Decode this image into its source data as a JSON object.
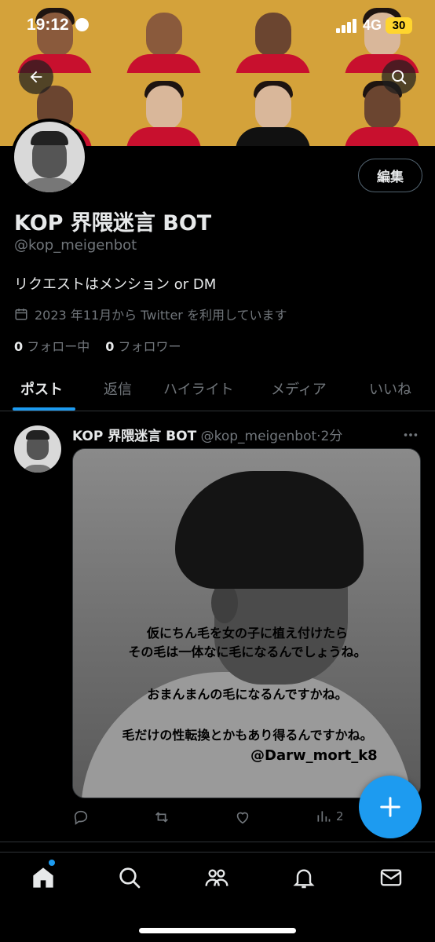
{
  "status_bar": {
    "time": "19:12",
    "network": "4G",
    "battery": "30"
  },
  "banner": {
    "description_icons": [
      "arrow-left-icon",
      "search-icon"
    ]
  },
  "profile": {
    "name": "KOP 界隈迷言 BOT",
    "handle": "@kop_meigenbot",
    "bio": "リクエストはメンション or DM",
    "joined": "2023 年11月から Twitter を利用しています",
    "following_count": "0",
    "following_label": "フォロー中",
    "followers_count": "0",
    "followers_label": "フォロワー",
    "edit_label": "編集"
  },
  "tabs": [
    {
      "label": "ポスト",
      "active": true
    },
    {
      "label": "返信",
      "active": false
    },
    {
      "label": "ハイライト",
      "active": false
    },
    {
      "label": "メディア",
      "active": false
    },
    {
      "label": "いいね",
      "active": false
    }
  ],
  "post": {
    "author_name": "KOP 界隈迷言 BOT",
    "author_handle": "@kop_meigenbot",
    "separator": "·",
    "time": "2分",
    "image_text": {
      "line1": "仮にちん毛を女の子に植え付けたら",
      "line2": "その毛は一体なに毛になるんでしょうね。",
      "line3": "おまんまんの毛になるんですかね。",
      "line4": "毛だけの性転換とかもあり得るんですかね。",
      "credit": "@Darw_mort_k8"
    },
    "views_count": "2"
  },
  "colors": {
    "accent": "#1d9bf0",
    "background": "#000000",
    "muted": "#71767b",
    "text": "#e7e9ea",
    "banner": "#c8942a",
    "battery": "#ffd52e"
  },
  "bottom_nav": [
    "home-icon",
    "search-icon",
    "communities-icon",
    "notifications-icon",
    "messages-icon"
  ]
}
